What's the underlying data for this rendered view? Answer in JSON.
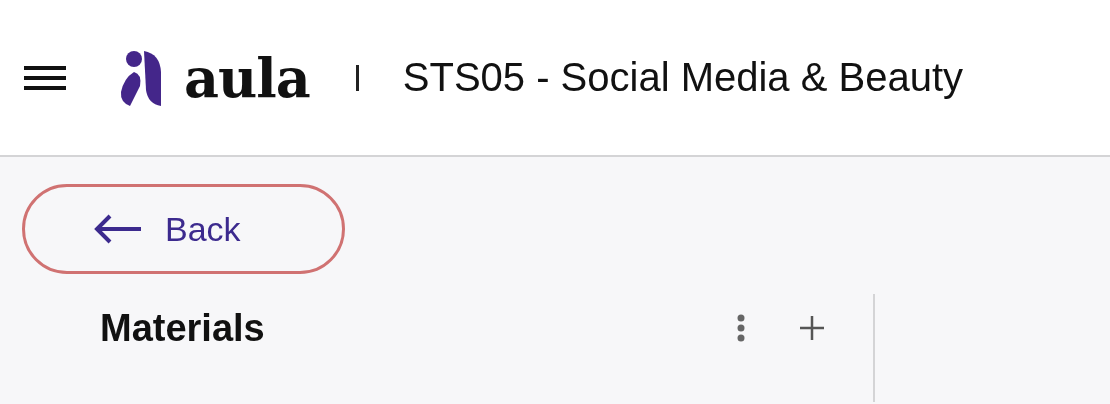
{
  "header": {
    "logo_text": "aula",
    "course_title": "STS05 - Social Media & Beauty"
  },
  "back_button": {
    "label": "Back"
  },
  "materials": {
    "title": "Materials"
  }
}
